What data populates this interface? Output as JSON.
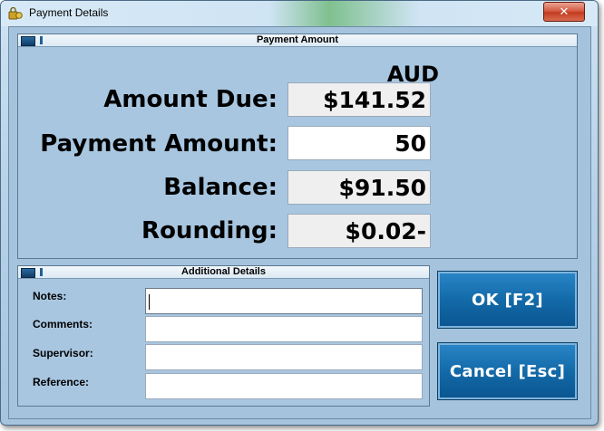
{
  "window": {
    "title": "Payment Details",
    "close_glyph": "✕",
    "icon": "lock-coin-icon"
  },
  "payment_amount": {
    "header": "Payment Amount",
    "currency": "AUD",
    "rows": [
      {
        "label": "Amount Due:",
        "value": "$141.52"
      },
      {
        "label": "Payment Amount:",
        "value": "50"
      },
      {
        "label": "Balance:",
        "value": "$91.50"
      },
      {
        "label": "Rounding:",
        "value": "$0.02-"
      }
    ]
  },
  "additional_details": {
    "header": "Additional Details",
    "fields": [
      {
        "label": "Notes:",
        "value": ""
      },
      {
        "label": "Comments:",
        "value": ""
      },
      {
        "label": "Supervisor:",
        "value": ""
      },
      {
        "label": "Reference:",
        "value": ""
      }
    ]
  },
  "buttons": {
    "ok": "OK  [F2]",
    "cancel": "Cancel [Esc]"
  },
  "colors": {
    "accent_button": "#136aa8",
    "panel_bg": "#a8c6e0",
    "close_button": "#c23a1f"
  }
}
